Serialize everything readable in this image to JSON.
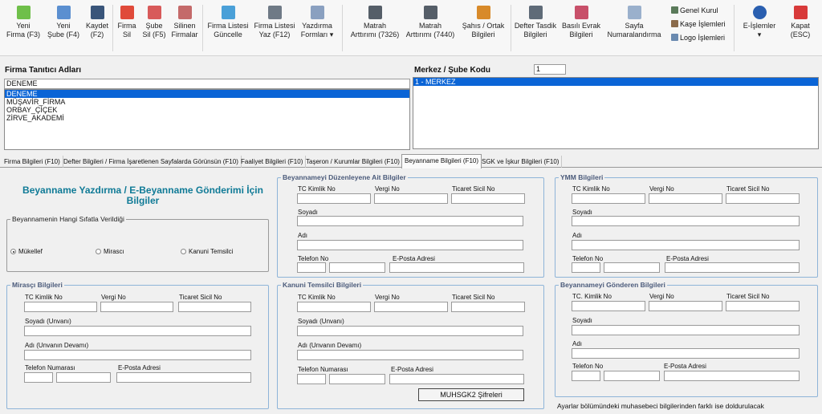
{
  "toolbar": {
    "yeni_firma": "Yeni\nFirma (F3)",
    "yeni_sube": "Yeni\nŞube (F4)",
    "kaydet": "Kaydet\n(F2)",
    "firma_sil": "Firma\nSil",
    "sube_sil": "Şube\nSil (F5)",
    "silinen": "Silinen\nFirmalar",
    "firma_listesi_guncelle": "Firma Listesi\nGüncelle",
    "firma_listesi_yaz": "Firma Listesi\nYaz (F12)",
    "yazdirma_formlari": "Yazdırma\nFormları ▾",
    "matrah_7326": "Matrah\nArttırımı (7326)",
    "matrah_7440": "Matrah\nArttırımı (7440)",
    "sahis_ortak": "Şahıs / Ortak\nBilgileri",
    "defter_tasdik": "Defter Tasdik\nBilgileri",
    "basili_evrak": "Basılı Evrak\nBilgileri",
    "sayfa_num": "Sayfa\nNumaralandırma",
    "genel_kurul": "Genel Kurul",
    "kase_islemleri": "Kaşe İşlemleri",
    "logo_islemleri": "Logo İşlemleri",
    "e_islemler": "E-İşlemler\n▾",
    "kapat": "Kapat\n(ESC)"
  },
  "firma": {
    "title": "Firma Tanıtıcı Adları",
    "search_value": "DENEME",
    "items": [
      "DENEME",
      "MÜŞAVİR_FİRMA",
      "ORBAY_ÇİÇEK",
      "ZİRVE_AKADEMİ"
    ]
  },
  "merkez": {
    "title": "Merkez / Şube Kodu",
    "code_value": "1",
    "items": [
      "1 - MERKEZ"
    ]
  },
  "tabs": [
    "Firma Bilgileri (F10)",
    "Defter Bilgileri / Firma İşaretlenen Sayfalarda Görünsün (F10)",
    "Faaliyet Bilgileri (F10)",
    "Taşeron / Kurumlar Bilgileri (F10)",
    "Beyanname Bilgileri (F10)",
    "SGK ve İşkur Bilgileri (F10)"
  ],
  "form": {
    "heading": "Beyanname Yazdırma  /  E-Beyanname Gönderimi İçin Bilgiler",
    "sifat": {
      "title": "Beyannamenin Hangi Sıfatla Verildiği",
      "options": [
        "Mükellef",
        "Mirascı",
        "Kanuni Temsilci"
      ],
      "selected": "Mükellef"
    },
    "duzenleyen": {
      "title": "Beyannameyi Düzenleyene Ait Bilgiler",
      "tc": "TC Kimlik No",
      "vergi": "Vergi No",
      "ticaret": "Ticaret Sicil No",
      "soyadi": "Soyadı",
      "adi": "Adı",
      "telefon": "Telefon No",
      "eposta": "E-Posta Adresi"
    },
    "ymm": {
      "title": "YMM Bilgileri",
      "tc": "TC Kimlik No",
      "vergi": "Vergi No",
      "ticaret": "Ticaret Sicil No",
      "soyadi": "Soyadı",
      "adi": "Adı",
      "telefon": "Telefon No",
      "eposta": "E-Posta Adresi"
    },
    "mirasci": {
      "title": "Mirasçı Bilgileri",
      "tc": "TC Kimlik No",
      "vergi": "Vergi No",
      "ticaret": "Ticaret Sicil No",
      "soyadi": "Soyadı (Unvanı)",
      "adi": "Adı (Unvanın Devamı)",
      "telefon": "Telefon Numarası",
      "eposta": "E-Posta Adresi"
    },
    "kanuni": {
      "title": "Kanuni Temsilci Bilgileri",
      "tc": "TC Kimlik No",
      "vergi": "Vergi No",
      "ticaret": "Ticaret Sicil No",
      "soyadi": "Soyadı (Unvanı)",
      "adi": "Adı (Unvanın Devamı)",
      "telefon": "Telefon Numarası",
      "eposta": "E-Posta Adresi",
      "button": "MUHSGK2 Şifreleri"
    },
    "gonderen": {
      "title": "Beyannameyi Gönderen Bilgileri",
      "tc": "TC. Kimlik No",
      "vergi": "Vergi No",
      "ticaret": "Ticaret Sicil No",
      "soyadi": "Soyadı",
      "adi": "Adı",
      "telefon": "Telefon No",
      "eposta": "E-Posta Adresi"
    },
    "note": "Ayarlar bölümündeki muhasebeci bilgilerinden farklı ise doldurulacak"
  },
  "colors": {
    "selection": "#0a64d6",
    "heading": "#0f7a96",
    "group_border": "#8eb4d8"
  },
  "icons": [
    "new-firm-icon",
    "new-branch-icon",
    "save-icon",
    "delete-icon",
    "delete-branch-icon",
    "deleted-firms-icon",
    "refresh-icon",
    "print-icon",
    "print-forms-icon",
    "ledger-icon",
    "ledger-icon",
    "people-icon",
    "book-icon",
    "cube-icon",
    "page-numbers-icon",
    "meeting-icon",
    "stamp-icon",
    "logo-icon",
    "e-operations-icon",
    "close-icon"
  ]
}
